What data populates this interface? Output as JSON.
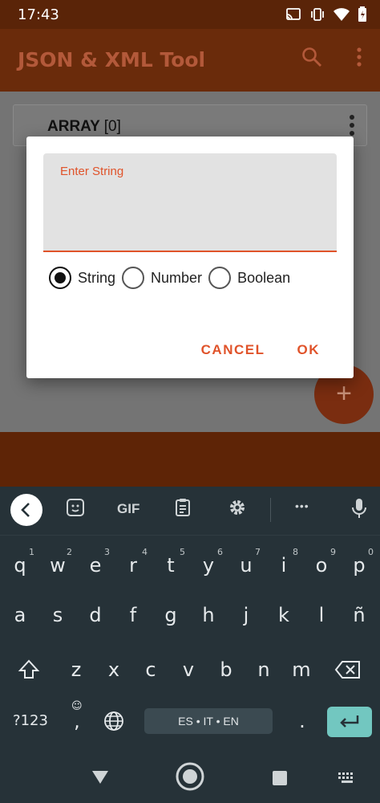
{
  "status_bar": {
    "time": "17:43",
    "icons": [
      "cast-icon",
      "vibrate-icon",
      "wifi-icon",
      "battery-charging-icon"
    ]
  },
  "app_bar": {
    "title": "JSON & XML Tool",
    "actions": [
      "search-icon",
      "more-vert-icon"
    ]
  },
  "content": {
    "array_label": "ARRAY",
    "array_count": "[0]"
  },
  "fab": {
    "icon": "plus-icon",
    "label": "+"
  },
  "dialog": {
    "input_hint": "Enter String",
    "input_value": "",
    "radio_options": [
      {
        "label": "String",
        "selected": true
      },
      {
        "label": "Number",
        "selected": false
      },
      {
        "label": "Boolean",
        "selected": false
      }
    ],
    "cancel_label": "CANCEL",
    "ok_label": "OK"
  },
  "keyboard": {
    "toolbar": {
      "gif_label": "GIF",
      "more_label": "•••",
      "items": [
        "back-arrow-icon",
        "sticker-icon",
        "gif-icon",
        "clipboard-icon",
        "gear-icon",
        "more-icon",
        "mic-icon"
      ]
    },
    "row1": [
      {
        "key": "q",
        "hint": "1"
      },
      {
        "key": "w",
        "hint": "2"
      },
      {
        "key": "e",
        "hint": "3"
      },
      {
        "key": "r",
        "hint": "4"
      },
      {
        "key": "t",
        "hint": "5"
      },
      {
        "key": "y",
        "hint": "6"
      },
      {
        "key": "u",
        "hint": "7"
      },
      {
        "key": "i",
        "hint": "8"
      },
      {
        "key": "o",
        "hint": "9"
      },
      {
        "key": "p",
        "hint": "0"
      }
    ],
    "row2": [
      "a",
      "s",
      "d",
      "f",
      "g",
      "h",
      "j",
      "k",
      "l",
      "ñ"
    ],
    "row3": [
      "z",
      "x",
      "c",
      "v",
      "b",
      "n",
      "m"
    ],
    "symbols_label": "?123",
    "comma_label": ",",
    "period_label": ".",
    "space_label": "ES • IT • EN"
  },
  "colors": {
    "accent": "#e0532a",
    "app_bar_dim": "#6a2b0b",
    "keyboard_bg": "#263238",
    "enter_key": "#72c7c0"
  }
}
